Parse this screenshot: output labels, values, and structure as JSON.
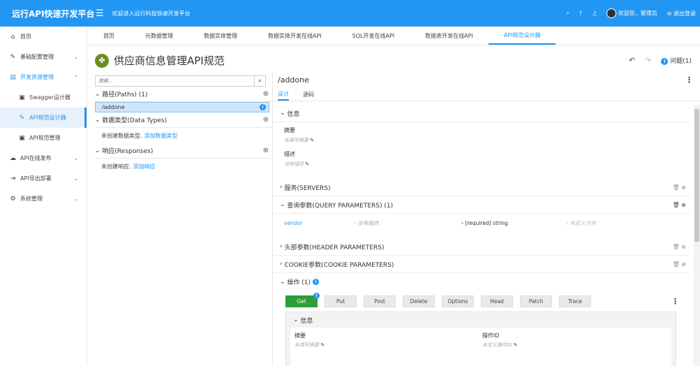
{
  "app": {
    "brand": "远行API快速开发平台",
    "welcome": "欢迎进入远行科技快速开发平台"
  },
  "topbar": {
    "user_greeting": "欢迎您，管理员",
    "logout": "退出登录"
  },
  "sidebar": {
    "items": [
      {
        "label": "首页",
        "icon": "home-icon"
      },
      {
        "label": "基础配置管理",
        "icon": "wrench-icon"
      },
      {
        "label": "开发资源管理",
        "icon": "folder-icon"
      },
      {
        "label": "Swagger设计器",
        "icon": "doc-icon"
      },
      {
        "label": "API规范设计器",
        "icon": "edit-icon"
      },
      {
        "label": "API规范管理",
        "icon": "list-icon"
      },
      {
        "label": "API在线发布",
        "icon": "cloud-icon"
      },
      {
        "label": "API导出部署",
        "icon": "export-icon"
      },
      {
        "label": "系统管理",
        "icon": "gear-icon"
      }
    ]
  },
  "tabs": [
    "首页",
    "元数据管理",
    "数据实体管理",
    "数据实体开发在线API",
    "SQL开发在线API",
    "数据表开发在线API",
    "API规范设计器"
  ],
  "page": {
    "title": "供应商信息管理API规范",
    "issues": "问题(1)",
    "issue_count": "i"
  },
  "left": {
    "search_placeholder": "搜索...",
    "paths_head": "路径(Paths) (1)",
    "path_item": "/addone",
    "types_head": "数据类型(Data Types)",
    "types_empty": "未创建数据类型.",
    "types_link": "添加数据类型",
    "resp_head": "响应(Responses)",
    "resp_empty": "未创建响应.",
    "resp_link": "添加响应"
  },
  "right": {
    "path_title": "/addone",
    "tab_design": "设计",
    "tab_source": "源码",
    "info_head": "信息",
    "summary_label": "摘要",
    "summary_val": "未填写摘要",
    "desc_label": "描述",
    "desc_val": "没有描述",
    "servers_head": "服务(SERVERS)",
    "query_head": "查询参数(QUERY PARAMETERS) (1)",
    "param_name": "vendor",
    "param_desc": "没有描述.",
    "param_type": "[required] string",
    "param_example": "未定义示例.",
    "header_head": "头部参数(HEADER PARAMETERS)",
    "cookie_head": "COOKIE参数(COOKIE PARAMETERS)",
    "ops_head": "操作 (1)",
    "ops": [
      "Get",
      "Put",
      "Post",
      "Delete",
      "Options",
      "Head",
      "Patch",
      "Trace"
    ],
    "op_info_head": "信息",
    "op_summary_label": "摘要",
    "op_summary_val": "未填写摘要",
    "op_id_label": "操作ID",
    "op_id_val": "未定义操作ID"
  },
  "colors": {
    "primary": "#2196f3",
    "get_active": "#2e9d3a"
  }
}
